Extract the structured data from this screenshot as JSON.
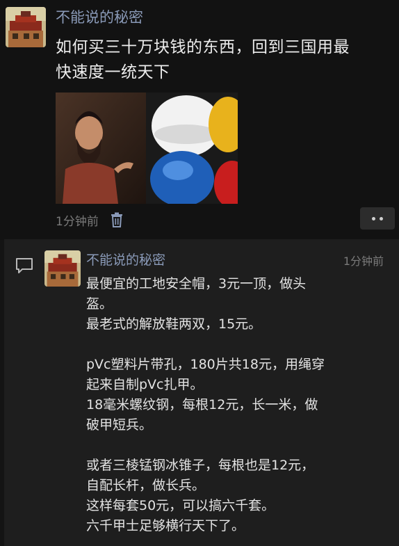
{
  "post": {
    "author": "不能说的秘密",
    "text_lines": [
      "如何买三十万块钱的东西，回到三国用最",
      "快速度一统天下"
    ],
    "time": "1分钟前",
    "images": [
      "photo-bearded-man-icon",
      "photo-safety-helmets-icon"
    ]
  },
  "comment": {
    "author": "不能说的秘密",
    "time": "1分钟前",
    "lines": [
      "最便宜的工地安全帽，3元一顶，做头",
      "盔。",
      "最老式的解放鞋两双，15元。",
      "",
      "pVc塑料片带孔，180片共18元，用绳穿",
      "起来自制pVc扎甲。",
      "18毫米螺纹钢，每根12元，长一米，做",
      "破甲短兵。",
      "",
      "或者三棱锰钢冰锥子，每根也是12元，",
      "自配长杆，做长兵。",
      "这样每套50元，可以搞六千套。",
      "六千甲士足够横行天下了。"
    ]
  },
  "colors": {
    "author": "#8a9ab8",
    "background": "#121212",
    "comment_bg": "#1e1e1e"
  }
}
